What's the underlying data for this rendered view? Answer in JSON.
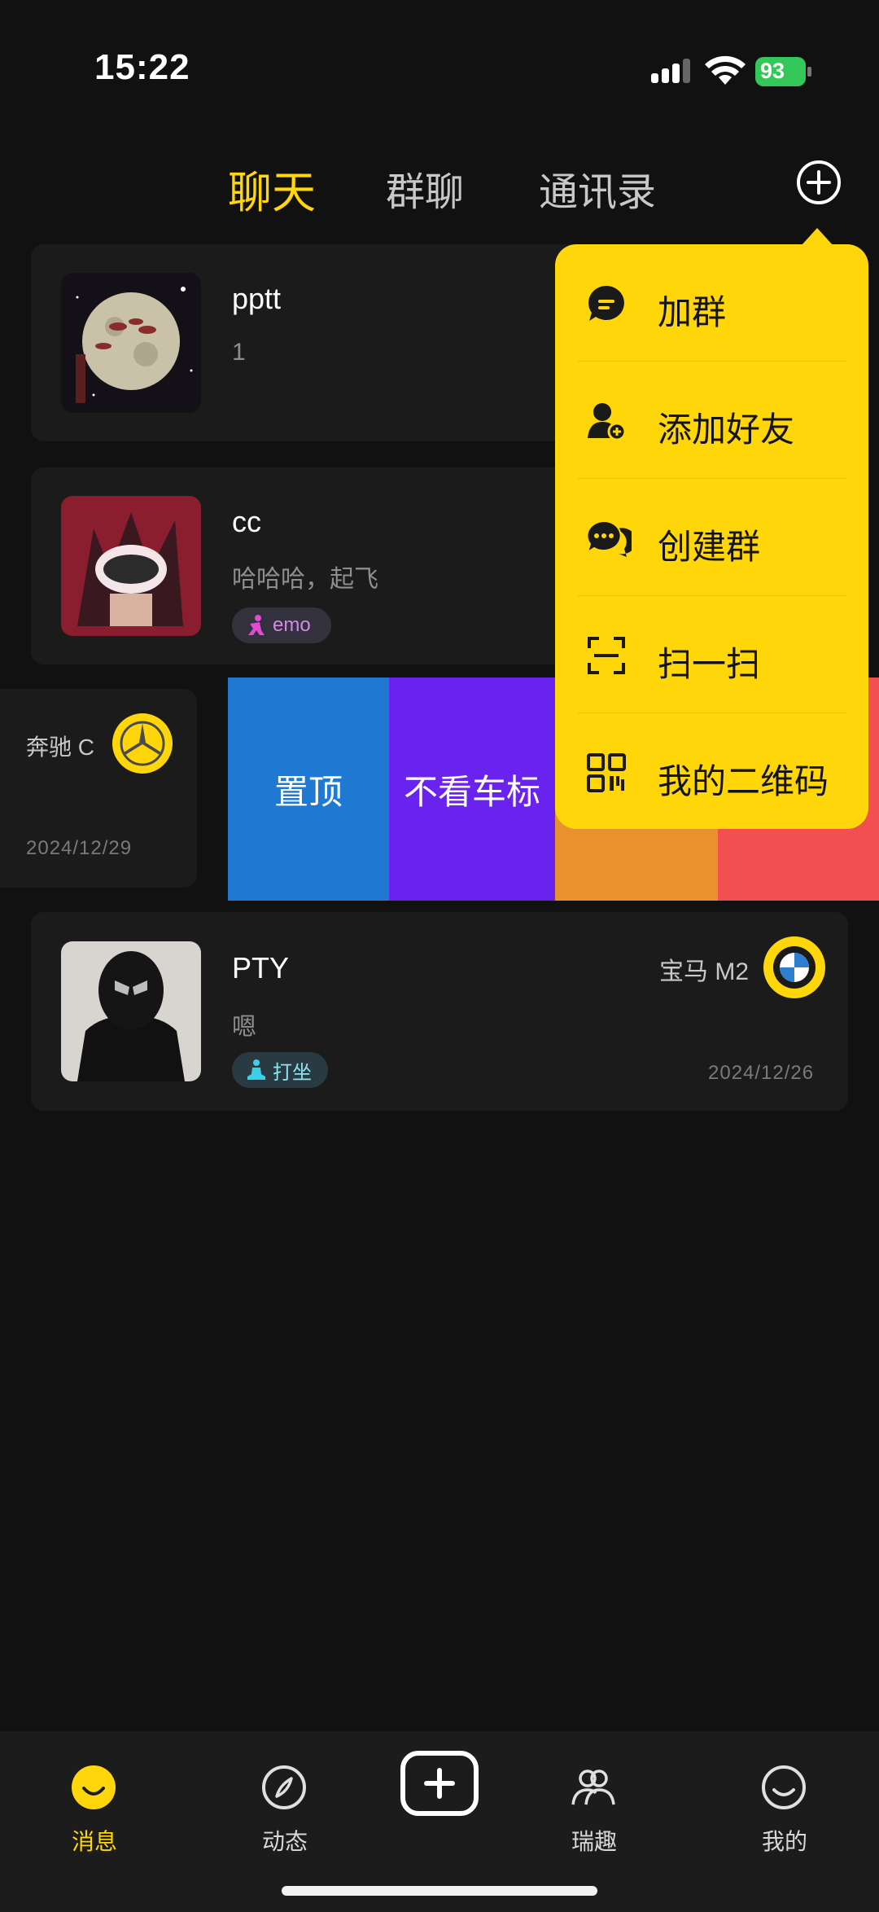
{
  "status": {
    "time": "15:22",
    "battery": "93"
  },
  "tabs": [
    {
      "label": "聊天",
      "active": true
    },
    {
      "label": "群聊"
    },
    {
      "label": "通讯录"
    }
  ],
  "chats": [
    {
      "name": "pptt",
      "preview": "1"
    },
    {
      "name": "cc",
      "preview": "哈哈哈，起飞",
      "tag": "emo"
    },
    {
      "car": "奔驰 C",
      "date": "2024/12/29"
    },
    {
      "name": "PTY",
      "preview": "嗯",
      "tag": "打坐",
      "car": "宝马 M2",
      "date": "2024/12/26"
    }
  ],
  "swipe_actions": [
    {
      "label": "置顶",
      "color": "#1f78d1"
    },
    {
      "label": "不看车标",
      "color": "#6a22ee"
    },
    {
      "label": "",
      "color": "#e8912e"
    },
    {
      "label": "",
      "color": "#f25050"
    }
  ],
  "menu": {
    "items": [
      {
        "label": "加群",
        "icon": "chat-bubble-icon"
      },
      {
        "label": "添加好友",
        "icon": "add-user-icon"
      },
      {
        "label": "创建群",
        "icon": "group-chat-icon"
      },
      {
        "label": "扫一扫",
        "icon": "scan-icon"
      },
      {
        "label": "我的二维码",
        "icon": "qr-code-icon"
      }
    ]
  },
  "nav": [
    {
      "label": "消息",
      "active": true
    },
    {
      "label": "动态"
    },
    {
      "label": ""
    },
    {
      "label": "瑞趣"
    },
    {
      "label": "我的"
    }
  ],
  "colors": {
    "accent": "#ffd60a",
    "background": "#111111",
    "card": "#1b1b1b"
  }
}
